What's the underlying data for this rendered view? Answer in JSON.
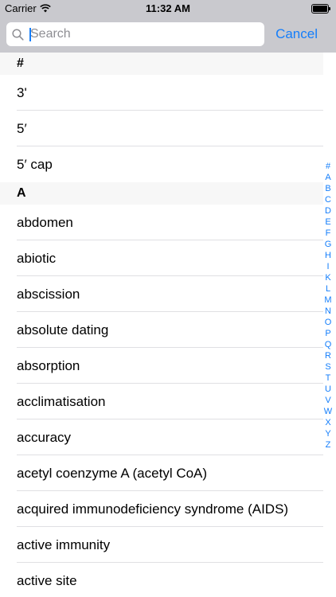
{
  "status_bar": {
    "carrier": "Carrier",
    "time": "11:32 AM"
  },
  "search": {
    "placeholder": "Search",
    "value": "",
    "cancel_label": "Cancel"
  },
  "sections": [
    {
      "header": "#",
      "items": [
        "3'",
        "5′",
        "5′ cap"
      ]
    },
    {
      "header": "A",
      "items": [
        "abdomen",
        "abiotic",
        "abscission",
        "absolute dating",
        "absorption",
        "acclimatisation",
        "accuracy",
        "acetyl coenzyme A (acetyl CoA)",
        "acquired immunodeficiency syndrome (AIDS)",
        "active immunity",
        "active site"
      ]
    }
  ],
  "index": [
    "#",
    "A",
    "B",
    "C",
    "D",
    "E",
    "F",
    "G",
    "H",
    "I",
    "K",
    "L",
    "M",
    "N",
    "O",
    "P",
    "Q",
    "R",
    "S",
    "T",
    "U",
    "V",
    "W",
    "X",
    "Y",
    "Z"
  ],
  "colors": {
    "accent": "#147efb",
    "bar_background": "#c9c9ce",
    "section_background": "#f7f7f7"
  },
  "icons": {
    "wifi": "wifi-icon",
    "battery": "battery-icon",
    "search": "search-icon"
  }
}
